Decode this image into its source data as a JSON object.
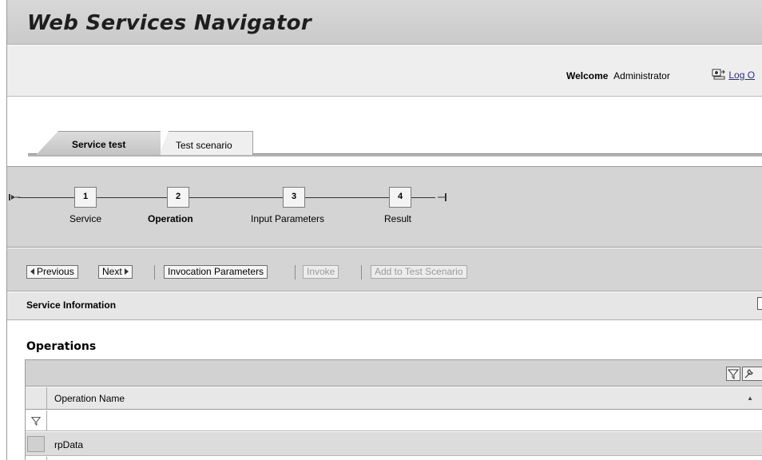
{
  "app": {
    "title": "Web Services Navigator"
  },
  "header": {
    "welcome_label": "Welcome",
    "user": "Administrator",
    "logoff_label": "Log O"
  },
  "tabs": [
    {
      "label": "Service test",
      "active": true
    },
    {
      "label": "Test scenario",
      "active": false
    }
  ],
  "roadmap": {
    "current_step": 2,
    "steps": [
      {
        "number": "1",
        "label": "Service"
      },
      {
        "number": "2",
        "label": "Operation"
      },
      {
        "number": "3",
        "label": "Input Parameters"
      },
      {
        "number": "4",
        "label": "Result"
      }
    ]
  },
  "toolbar": {
    "previous_label": "Previous",
    "next_label": "Next",
    "invocation_label": "Invocation Parameters",
    "invoke_label": "Invoke",
    "add_label": "Add to Test Scenario"
  },
  "tray": {
    "title": "Service Information"
  },
  "operations": {
    "title": "Operations",
    "column_header": "Operation Name",
    "rows": [
      {
        "name": "rpData",
        "selected": true
      }
    ]
  },
  "icons": [
    "roadmap-start-icon",
    "roadmap-end-icon",
    "logoff-icon",
    "filter-icon",
    "settings-icon",
    "sort-icon",
    "tray-expand-icon"
  ],
  "colors": {
    "title_bar": "#cacaca",
    "roadmap_bg": "#d4d4d4",
    "selected_row": "#dcdcdc",
    "link": "#2b2b8c"
  }
}
